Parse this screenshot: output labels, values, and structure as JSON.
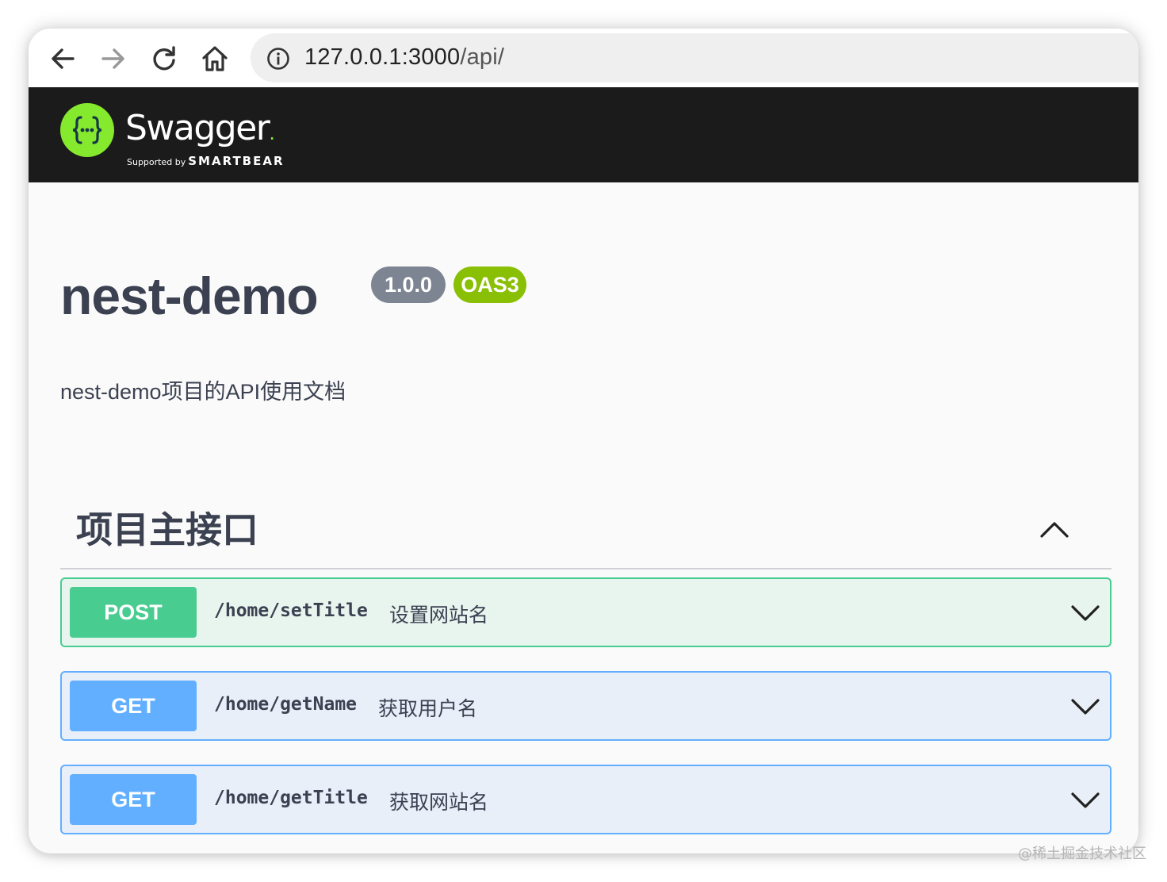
{
  "browser": {
    "back_icon": "arrow-left-icon",
    "forward_icon": "arrow-right-icon",
    "reload_icon": "reload-icon",
    "home_icon": "home-icon",
    "info_icon": "info-icon",
    "url_host": "127.0.0.1:3000",
    "url_path": "/api/"
  },
  "swagger": {
    "logo_icon": "swagger-braces-icon",
    "brand": "Swagger",
    "supported_by": "Supported by",
    "company": "SMARTBEAR",
    "brand_color": "#85ea2d"
  },
  "info": {
    "title": "nest-demo",
    "version": "1.0.0",
    "oas": "OAS3",
    "description": "nest-demo项目的API使用文档"
  },
  "tag": {
    "name": "项目主接口",
    "toggle_icon": "chevron-up-icon"
  },
  "operations": [
    {
      "method": "POST",
      "path": "/home/setTitle",
      "summary": "设置网站名",
      "color": "#49cc90"
    },
    {
      "method": "GET",
      "path": "/home/getName",
      "summary": "获取用户名",
      "color": "#61affe"
    },
    {
      "method": "GET",
      "path": "/home/getTitle",
      "summary": "获取网站名",
      "color": "#61affe"
    }
  ],
  "watermark": "@稀土掘金技术社区"
}
